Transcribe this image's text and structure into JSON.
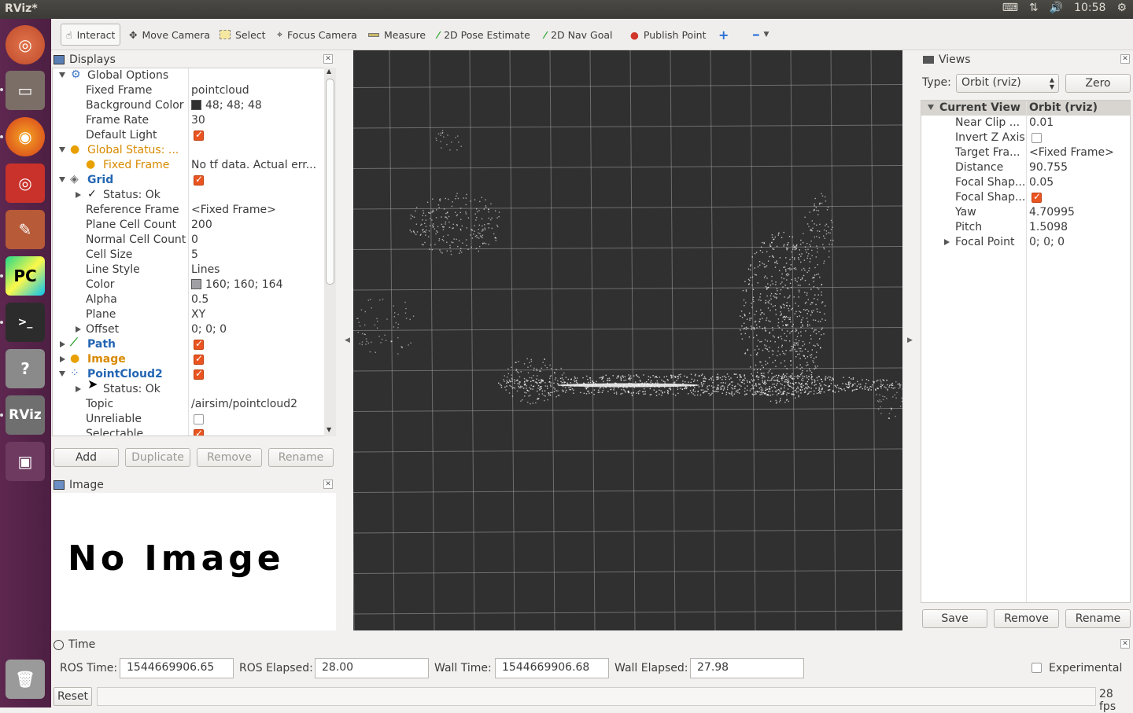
{
  "window": {
    "title": "RViz*"
  },
  "tray": {
    "clock": "10:58"
  },
  "toolbar": {
    "tools": [
      {
        "label": "Interact",
        "icon": "hand-icon"
      },
      {
        "label": "Move Camera",
        "icon": "move-camera-icon"
      },
      {
        "label": "Select",
        "icon": "select-icon"
      },
      {
        "label": "Focus Camera",
        "icon": "focus-camera-icon"
      },
      {
        "label": "Measure",
        "icon": "ruler-icon"
      },
      {
        "label": "2D Pose Estimate",
        "icon": "green-arrow-icon"
      },
      {
        "label": "2D Nav Goal",
        "icon": "green-arrow-icon"
      },
      {
        "label": "Publish Point",
        "icon": "map-pin-icon"
      }
    ]
  },
  "displays": {
    "title": "Displays",
    "rows": [
      {
        "key": "Global Options",
        "value": ""
      },
      {
        "key": "Fixed Frame",
        "value": "pointcloud"
      },
      {
        "key": "Background Color",
        "value": "48; 48; 48"
      },
      {
        "key": "Frame Rate",
        "value": "30"
      },
      {
        "key": "Default Light",
        "value": ""
      },
      {
        "key": "Global Status: ...",
        "value": ""
      },
      {
        "key": "Fixed Frame",
        "value": "No tf data.  Actual err..."
      },
      {
        "key": "Grid",
        "value": ""
      },
      {
        "key": "Status: Ok",
        "value": ""
      },
      {
        "key": "Reference Frame",
        "value": "<Fixed Frame>"
      },
      {
        "key": "Plane Cell Count",
        "value": "200"
      },
      {
        "key": "Normal Cell Count",
        "value": "0"
      },
      {
        "key": "Cell Size",
        "value": "5"
      },
      {
        "key": "Line Style",
        "value": "Lines"
      },
      {
        "key": "Color",
        "value": "160; 160; 164"
      },
      {
        "key": "Alpha",
        "value": "0.5"
      },
      {
        "key": "Plane",
        "value": "XY"
      },
      {
        "key": "Offset",
        "value": "0; 0; 0"
      },
      {
        "key": "Path",
        "value": ""
      },
      {
        "key": "Image",
        "value": ""
      },
      {
        "key": "PointCloud2",
        "value": ""
      },
      {
        "key": "Status: Ok",
        "value": ""
      },
      {
        "key": "Topic",
        "value": "/airsim/pointcloud2"
      },
      {
        "key": "Unreliable",
        "value": ""
      },
      {
        "key": "Selectable",
        "value": ""
      }
    ],
    "buttons": {
      "add": "Add",
      "duplicate": "Duplicate",
      "remove": "Remove",
      "rename": "Rename"
    }
  },
  "image_panel": {
    "title": "Image",
    "message": "No Image"
  },
  "views": {
    "title": "Views",
    "type_label": "Type:",
    "type_value": "Orbit (rviz)",
    "zero_label": "Zero",
    "header_key": "Current View",
    "header_value": "Orbit (rviz)",
    "rows": [
      {
        "key": "Near Clip ...",
        "value": "0.01"
      },
      {
        "key": "Invert Z Axis",
        "value": ""
      },
      {
        "key": "Target Fra...",
        "value": "<Fixed Frame>"
      },
      {
        "key": "Distance",
        "value": "90.755"
      },
      {
        "key": "Focal Shap...",
        "value": "0.05"
      },
      {
        "key": "Focal Shap...",
        "value": ""
      },
      {
        "key": "Yaw",
        "value": "4.70995"
      },
      {
        "key": "Pitch",
        "value": "1.5098"
      },
      {
        "key": "Focal Point",
        "value": "0; 0; 0"
      }
    ],
    "buttons": {
      "save": "Save",
      "remove": "Remove",
      "rename": "Rename"
    }
  },
  "time": {
    "title": "Time",
    "ros_time_label": "ROS Time:",
    "ros_time": "1544669906.65",
    "ros_elapsed_label": "ROS Elapsed:",
    "ros_elapsed": "28.00",
    "wall_time_label": "Wall Time:",
    "wall_time": "1544669906.68",
    "wall_elapsed_label": "Wall Elapsed:",
    "wall_elapsed": "27.98",
    "experimental_label": "Experimental"
  },
  "status": {
    "reset_label": "Reset",
    "fps": "28 fps"
  },
  "colors": {
    "background": "#303030",
    "grid": "#a0a0a4",
    "accent": "#e95420",
    "launcher": "#5e2750"
  }
}
